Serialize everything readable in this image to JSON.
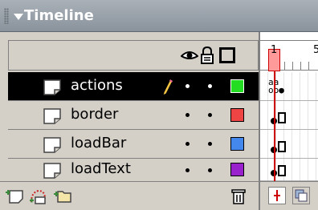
{
  "panel": {
    "title": "Timeline"
  },
  "frames": {
    "ruler_labels": [
      "1",
      "5"
    ],
    "playhead_frame": 1
  },
  "layers": [
    {
      "name": "actions",
      "color": "#22dd22",
      "selected": true,
      "has_actionscript": true
    },
    {
      "name": "border",
      "color": "#ee4444",
      "selected": false,
      "has_actionscript": false
    },
    {
      "name": "loadBar",
      "color": "#4488ee",
      "selected": false,
      "has_actionscript": false
    },
    {
      "name": "loadText",
      "color": "#9922cc",
      "selected": false,
      "has_actionscript": false
    }
  ],
  "icons": {
    "header": [
      "eye-icon",
      "lock-icon",
      "outline-icon"
    ],
    "footer": [
      "insert-layer-icon",
      "add-motion-guide-icon",
      "insert-layer-folder-icon",
      "delete-layer-icon"
    ],
    "row": [
      "layer-icon",
      "pencil-icon"
    ]
  },
  "actions_marks": "a",
  "colors": {
    "title_bar": "#8a939c",
    "panel_bg": "#d4d0c8",
    "selected_row": "#000000",
    "playhead": "#cc0000"
  }
}
